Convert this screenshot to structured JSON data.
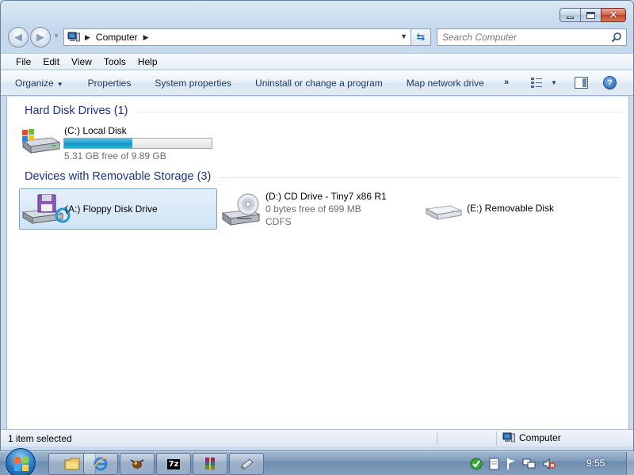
{
  "window": {
    "address_path": "Computer",
    "search_placeholder": "Search Computer"
  },
  "menu": {
    "file": "File",
    "edit": "Edit",
    "view": "View",
    "tools": "Tools",
    "help": "Help"
  },
  "command_bar": {
    "organize": "Organize",
    "properties": "Properties",
    "system_properties": "System properties",
    "uninstall": "Uninstall or change a program",
    "map_network_drive": "Map network drive",
    "more": "»"
  },
  "groups": {
    "hard_disk": "Hard Disk Drives (1)",
    "removable": "Devices with Removable Storage (3)"
  },
  "drives": {
    "local_disk": {
      "name": "(C:) Local Disk",
      "free_text": "5.31 GB free of 9.89 GB",
      "used_fraction": 0.463
    },
    "floppy": {
      "name": "(A:) Floppy Disk Drive"
    },
    "cd": {
      "name": "(D:) CD Drive - Tiny7 x86 R1",
      "free_text": "0 bytes free of 699 MB",
      "filesystem": "CDFS"
    },
    "removable": {
      "name": "(E:) Removable Disk"
    }
  },
  "status_bar": {
    "selection": "1 item selected",
    "location": "Computer"
  },
  "taskbar": {
    "clock": "9:55",
    "app_7zip_label": "7z"
  },
  "colors": {
    "header_text": "#1e3287",
    "selection_bg": "#cfe4f7",
    "capacity_fill": "#1f9fd1"
  }
}
